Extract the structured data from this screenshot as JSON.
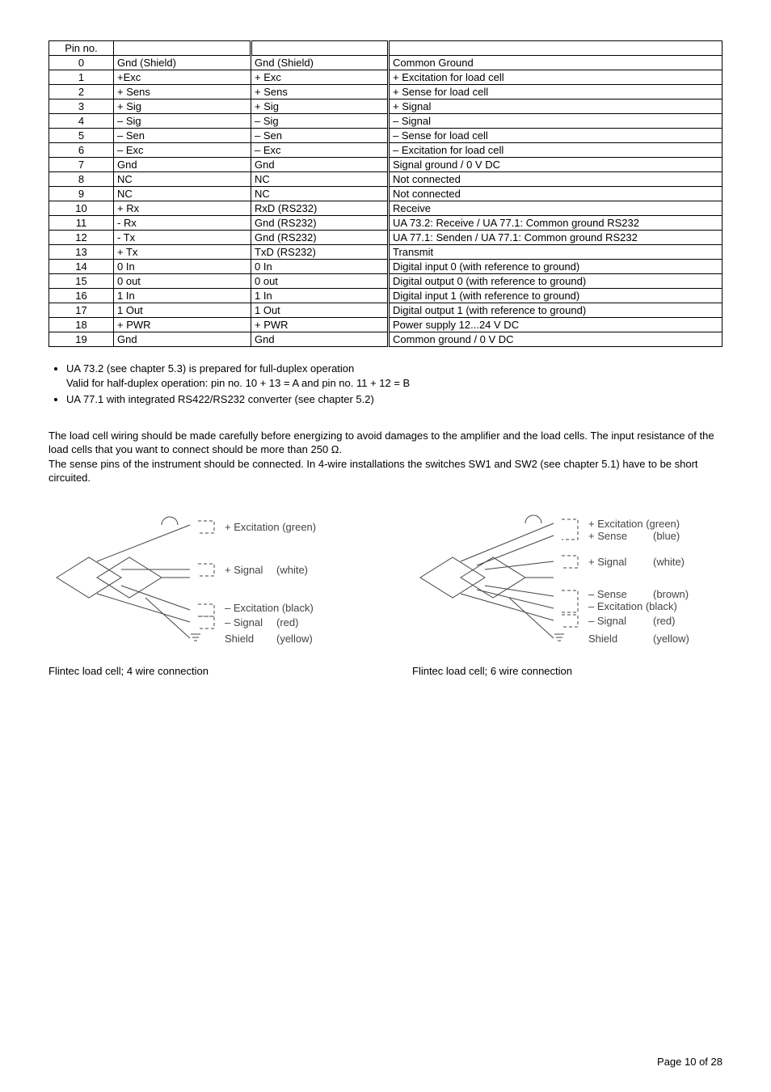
{
  "table": {
    "head": [
      "Pin no.",
      "",
      "",
      ""
    ],
    "rows": [
      [
        "0",
        "Gnd (Shield)",
        "Gnd (Shield)",
        "Common Ground"
      ],
      [
        "1",
        "+Exc",
        "+ Exc",
        "+ Excitation for load cell"
      ],
      [
        "2",
        "+ Sens",
        "+ Sens",
        "+ Sense for load cell"
      ],
      [
        "3",
        "+ Sig",
        "+ Sig",
        "+ Signal"
      ],
      [
        "4",
        "– Sig",
        "– Sig",
        "– Signal"
      ],
      [
        "5",
        "– Sen",
        "– Sen",
        "– Sense for load cell"
      ],
      [
        "6",
        "– Exc",
        "– Exc",
        "– Excitation for load cell"
      ],
      [
        "7",
        "Gnd",
        "Gnd",
        "Signal ground / 0 V DC"
      ],
      [
        "8",
        "NC",
        "NC",
        "Not connected"
      ],
      [
        "9",
        "NC",
        "NC",
        "Not connected"
      ],
      [
        "10",
        "+ Rx",
        "RxD (RS232)",
        "Receive"
      ],
      [
        "11",
        "- Rx",
        "Gnd (RS232)",
        "UA 73.2: Receive / UA 77.1: Common ground RS232"
      ],
      [
        "12",
        "- Tx",
        "Gnd (RS232)",
        "UA 77.1: Senden / UA 77.1: Common ground RS232"
      ],
      [
        "13",
        "+ Tx",
        "TxD (RS232)",
        "Transmit"
      ],
      [
        "14",
        "0 In",
        "0 In",
        "Digital input 0 (with reference to ground)"
      ],
      [
        "15",
        "0 out",
        "0 out",
        "Digital output 0 (with reference to ground)"
      ],
      [
        "16",
        "1 In",
        "1 In",
        "Digital input 1 (with reference to ground)"
      ],
      [
        "17",
        "1 Out",
        "1 Out",
        "Digital output 1 (with reference to ground)"
      ],
      [
        "18",
        "+ PWR",
        "+ PWR",
        "Power supply 12...24 V DC"
      ],
      [
        "19",
        "Gnd",
        "Gnd",
        "Common ground / 0 V DC"
      ]
    ]
  },
  "bullets": {
    "b1": "UA 73.2 (see chapter 5.3) is prepared for full-duplex operation",
    "b1b": "Valid for half-duplex operation: pin no. 10 + 13 = A  and  pin no. 11 + 12 = B",
    "b2": "UA 77.1 with integrated RS422/RS232 converter (see chapter 5.2)"
  },
  "para": "The load cell wiring should be made carefully before energizing to avoid damages to the amplifier and the load cells. The input resistance of the load cells that you want to connect should be more than 250 Ω.\nThe sense pins of the instrument should be connected. In 4-wire installations the switches SW1 and SW2 (see chapter 5.1) have to be short circuited.",
  "diag4": {
    "caption": "Flintec load cell; 4 wire connection",
    "labels": {
      "excp": "+ Excitation",
      "excp_c": "(green)",
      "sigp": "+ Signal",
      "sigp_c": "(white)",
      "excn": "– Excitation",
      "excn_c": "(black)",
      "sign": "– Signal",
      "sign_c": "(red)",
      "sh": "Shield",
      "sh_c": "(yellow)"
    }
  },
  "diag6": {
    "caption": "Flintec load cell; 6 wire connection",
    "labels": {
      "excp": "+ Excitation",
      "excp_c": "(green)",
      "senp": "+ Sense",
      "senp_c": "(blue)",
      "sigp": "+ Signal",
      "sigp_c": "(white)",
      "senn": "– Sense",
      "senn_c": "(brown)",
      "excn": "– Excitation",
      "excn_c": "(black)",
      "sign": "– Signal",
      "sign_c": "(red)",
      "sh": "Shield",
      "sh_c": "(yellow)"
    }
  },
  "footer": "Page 10 of 28"
}
